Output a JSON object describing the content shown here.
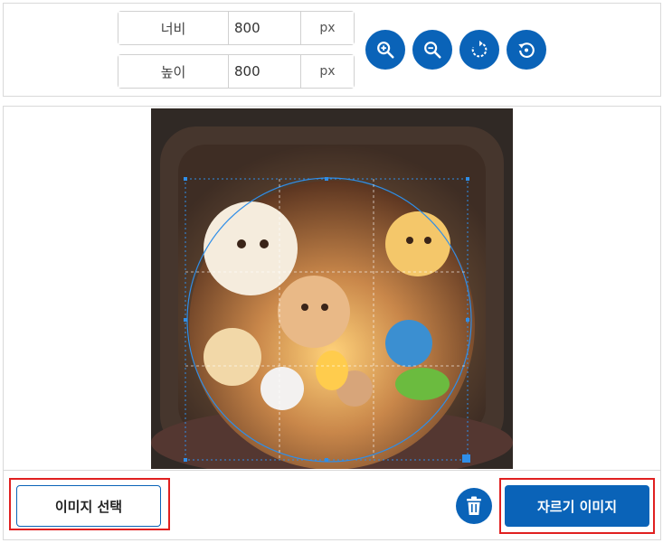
{
  "dimensions": {
    "width": {
      "label": "너비",
      "value": "800",
      "unit": "px"
    },
    "height": {
      "label": "높이",
      "value": "800",
      "unit": "px"
    }
  },
  "toolbar": {
    "icons": [
      "zoom-in-icon",
      "zoom-out-icon",
      "rotate-icon",
      "reset-icon"
    ]
  },
  "actions": {
    "select_image_label": "이미지 선택",
    "crop_image_label": "자르기 이미지",
    "delete_icon": "trash-icon"
  },
  "colors": {
    "accent": "#0a63b8",
    "highlight_outline": "#e02020",
    "crop_handle": "#2f8ee8"
  }
}
